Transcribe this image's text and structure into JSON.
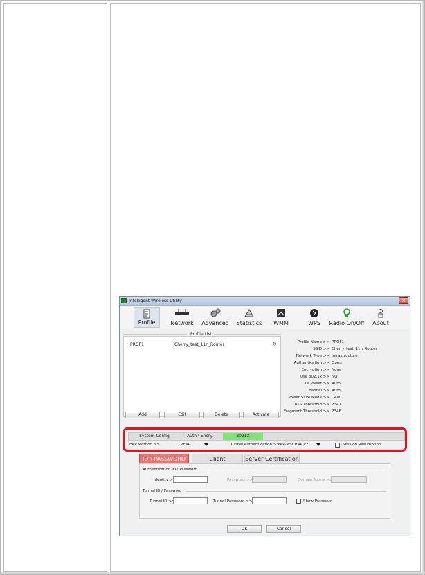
{
  "window": {
    "title": "Intelligent Wireless Utility",
    "close_label": "×"
  },
  "toolbar": {
    "items": [
      {
        "label": "Profile",
        "icon": "profile-icon"
      },
      {
        "label": "Network",
        "icon": "network-icon"
      },
      {
        "label": "Advanced",
        "icon": "advanced-icon"
      },
      {
        "label": "Statistics",
        "icon": "statistics-icon"
      },
      {
        "label": "WMM",
        "icon": "wmm-icon"
      },
      {
        "label": "WPS",
        "icon": "wps-icon"
      },
      {
        "label": "Radio On/Off",
        "icon": "radio-icon"
      },
      {
        "label": "About",
        "icon": "about-icon"
      }
    ],
    "active": "Profile"
  },
  "profile_list": {
    "title": "Profile List",
    "rows": [
      {
        "name": "PROF1",
        "ssid": "Cherry_test_11n_Router"
      }
    ],
    "buttons": {
      "add": "Add",
      "edit": "Edit",
      "delete": "Delete",
      "activate": "Activate"
    }
  },
  "details": [
    {
      "label": "Profile Name >>",
      "value": "PROF1"
    },
    {
      "label": "SSID >>",
      "value": "Cherry_test_11n_Router"
    },
    {
      "label": "Network Type >>",
      "value": "Infrastructure"
    },
    {
      "label": "Authentication >>",
      "value": "Open"
    },
    {
      "label": "Encryption >>",
      "value": "None"
    },
    {
      "label": "Use 802.1x >>",
      "value": "NO"
    },
    {
      "label": "Tx Power >>",
      "value": "Auto"
    },
    {
      "label": "Channel >>",
      "value": "Auto"
    },
    {
      "label": "Power Save Mode >>",
      "value": "CAM"
    },
    {
      "label": "RTS Threshold >>",
      "value": "2347"
    },
    {
      "label": "Fragment Threshold >>",
      "value": "2346"
    }
  ],
  "subtabs": {
    "system_config": "System Config",
    "auth_encry": "Auth \\ Encry.",
    "8021x": "8021X"
  },
  "eap": {
    "method_label": "EAP Method >>",
    "method_value": "PEAP",
    "tunnel_auth_label": "Tunnel Authentication >>",
    "tunnel_auth_value": "EAP-MSCHAP v2",
    "session_resumption": "Session Resumption"
  },
  "cred_tabs": {
    "id_password": "ID \\ PASSWORD",
    "client_cert": "Client Certification",
    "server_cert": "Server Certification"
  },
  "auth_group": {
    "title": "Authentication ID / Password",
    "identity_label": "Identity >>",
    "password_label": "Password >>",
    "domain_label": "Domain Name >>"
  },
  "tunnel_group": {
    "title": "Tunnel ID / Password",
    "tunnel_id_label": "Tunnel ID >>",
    "tunnel_password_label": "Tunnel Password >>",
    "show_password": "Show Password"
  },
  "footer_buttons": {
    "ok": "OK",
    "cancel": "Cancel"
  },
  "colors": {
    "highlight": "#e0141e",
    "active_subtab": "#86e07a",
    "active_cred_tab": "#e87474"
  }
}
